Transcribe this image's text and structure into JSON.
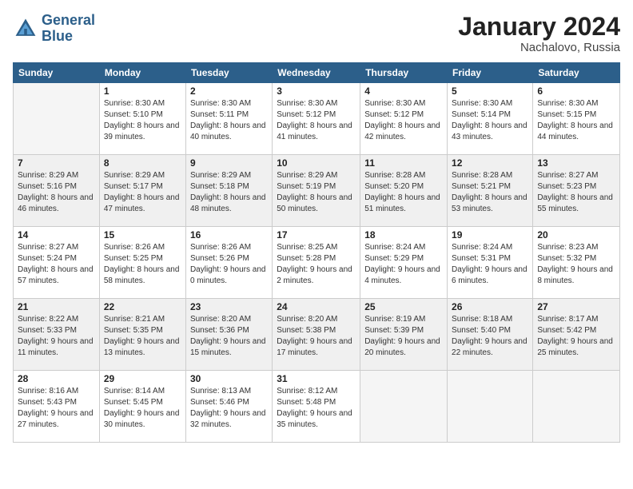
{
  "header": {
    "logo_line1": "General",
    "logo_line2": "Blue",
    "month_title": "January 2024",
    "location": "Nachalovo, Russia"
  },
  "weekdays": [
    "Sunday",
    "Monday",
    "Tuesday",
    "Wednesday",
    "Thursday",
    "Friday",
    "Saturday"
  ],
  "weeks": [
    [
      {
        "day": "",
        "empty": true
      },
      {
        "day": "1",
        "sunrise": "Sunrise: 8:30 AM",
        "sunset": "Sunset: 5:10 PM",
        "daylight": "Daylight: 8 hours and 39 minutes."
      },
      {
        "day": "2",
        "sunrise": "Sunrise: 8:30 AM",
        "sunset": "Sunset: 5:11 PM",
        "daylight": "Daylight: 8 hours and 40 minutes."
      },
      {
        "day": "3",
        "sunrise": "Sunrise: 8:30 AM",
        "sunset": "Sunset: 5:12 PM",
        "daylight": "Daylight: 8 hours and 41 minutes."
      },
      {
        "day": "4",
        "sunrise": "Sunrise: 8:30 AM",
        "sunset": "Sunset: 5:12 PM",
        "daylight": "Daylight: 8 hours and 42 minutes."
      },
      {
        "day": "5",
        "sunrise": "Sunrise: 8:30 AM",
        "sunset": "Sunset: 5:14 PM",
        "daylight": "Daylight: 8 hours and 43 minutes."
      },
      {
        "day": "6",
        "sunrise": "Sunrise: 8:30 AM",
        "sunset": "Sunset: 5:15 PM",
        "daylight": "Daylight: 8 hours and 44 minutes."
      }
    ],
    [
      {
        "day": "7",
        "sunrise": "Sunrise: 8:29 AM",
        "sunset": "Sunset: 5:16 PM",
        "daylight": "Daylight: 8 hours and 46 minutes."
      },
      {
        "day": "8",
        "sunrise": "Sunrise: 8:29 AM",
        "sunset": "Sunset: 5:17 PM",
        "daylight": "Daylight: 8 hours and 47 minutes."
      },
      {
        "day": "9",
        "sunrise": "Sunrise: 8:29 AM",
        "sunset": "Sunset: 5:18 PM",
        "daylight": "Daylight: 8 hours and 48 minutes."
      },
      {
        "day": "10",
        "sunrise": "Sunrise: 8:29 AM",
        "sunset": "Sunset: 5:19 PM",
        "daylight": "Daylight: 8 hours and 50 minutes."
      },
      {
        "day": "11",
        "sunrise": "Sunrise: 8:28 AM",
        "sunset": "Sunset: 5:20 PM",
        "daylight": "Daylight: 8 hours and 51 minutes."
      },
      {
        "day": "12",
        "sunrise": "Sunrise: 8:28 AM",
        "sunset": "Sunset: 5:21 PM",
        "daylight": "Daylight: 8 hours and 53 minutes."
      },
      {
        "day": "13",
        "sunrise": "Sunrise: 8:27 AM",
        "sunset": "Sunset: 5:23 PM",
        "daylight": "Daylight: 8 hours and 55 minutes."
      }
    ],
    [
      {
        "day": "14",
        "sunrise": "Sunrise: 8:27 AM",
        "sunset": "Sunset: 5:24 PM",
        "daylight": "Daylight: 8 hours and 57 minutes."
      },
      {
        "day": "15",
        "sunrise": "Sunrise: 8:26 AM",
        "sunset": "Sunset: 5:25 PM",
        "daylight": "Daylight: 8 hours and 58 minutes."
      },
      {
        "day": "16",
        "sunrise": "Sunrise: 8:26 AM",
        "sunset": "Sunset: 5:26 PM",
        "daylight": "Daylight: 9 hours and 0 minutes."
      },
      {
        "day": "17",
        "sunrise": "Sunrise: 8:25 AM",
        "sunset": "Sunset: 5:28 PM",
        "daylight": "Daylight: 9 hours and 2 minutes."
      },
      {
        "day": "18",
        "sunrise": "Sunrise: 8:24 AM",
        "sunset": "Sunset: 5:29 PM",
        "daylight": "Daylight: 9 hours and 4 minutes."
      },
      {
        "day": "19",
        "sunrise": "Sunrise: 8:24 AM",
        "sunset": "Sunset: 5:31 PM",
        "daylight": "Daylight: 9 hours and 6 minutes."
      },
      {
        "day": "20",
        "sunrise": "Sunrise: 8:23 AM",
        "sunset": "Sunset: 5:32 PM",
        "daylight": "Daylight: 9 hours and 8 minutes."
      }
    ],
    [
      {
        "day": "21",
        "sunrise": "Sunrise: 8:22 AM",
        "sunset": "Sunset: 5:33 PM",
        "daylight": "Daylight: 9 hours and 11 minutes."
      },
      {
        "day": "22",
        "sunrise": "Sunrise: 8:21 AM",
        "sunset": "Sunset: 5:35 PM",
        "daylight": "Daylight: 9 hours and 13 minutes."
      },
      {
        "day": "23",
        "sunrise": "Sunrise: 8:20 AM",
        "sunset": "Sunset: 5:36 PM",
        "daylight": "Daylight: 9 hours and 15 minutes."
      },
      {
        "day": "24",
        "sunrise": "Sunrise: 8:20 AM",
        "sunset": "Sunset: 5:38 PM",
        "daylight": "Daylight: 9 hours and 17 minutes."
      },
      {
        "day": "25",
        "sunrise": "Sunrise: 8:19 AM",
        "sunset": "Sunset: 5:39 PM",
        "daylight": "Daylight: 9 hours and 20 minutes."
      },
      {
        "day": "26",
        "sunrise": "Sunrise: 8:18 AM",
        "sunset": "Sunset: 5:40 PM",
        "daylight": "Daylight: 9 hours and 22 minutes."
      },
      {
        "day": "27",
        "sunrise": "Sunrise: 8:17 AM",
        "sunset": "Sunset: 5:42 PM",
        "daylight": "Daylight: 9 hours and 25 minutes."
      }
    ],
    [
      {
        "day": "28",
        "sunrise": "Sunrise: 8:16 AM",
        "sunset": "Sunset: 5:43 PM",
        "daylight": "Daylight: 9 hours and 27 minutes."
      },
      {
        "day": "29",
        "sunrise": "Sunrise: 8:14 AM",
        "sunset": "Sunset: 5:45 PM",
        "daylight": "Daylight: 9 hours and 30 minutes."
      },
      {
        "day": "30",
        "sunrise": "Sunrise: 8:13 AM",
        "sunset": "Sunset: 5:46 PM",
        "daylight": "Daylight: 9 hours and 32 minutes."
      },
      {
        "day": "31",
        "sunrise": "Sunrise: 8:12 AM",
        "sunset": "Sunset: 5:48 PM",
        "daylight": "Daylight: 9 hours and 35 minutes."
      },
      {
        "day": "",
        "empty": true
      },
      {
        "day": "",
        "empty": true
      },
      {
        "day": "",
        "empty": true
      }
    ]
  ]
}
